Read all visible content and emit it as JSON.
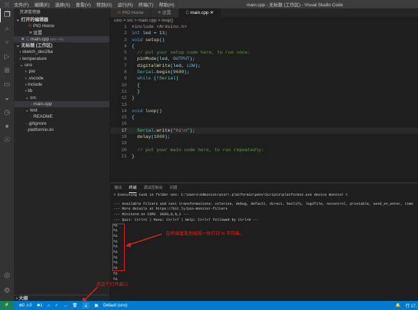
{
  "title": {
    "menus": [
      "文件(F)",
      "编辑(E)",
      "选择(S)",
      "查看(V)",
      "转到(G)",
      "运行(R)",
      "终端(T)",
      "帮助(H)"
    ],
    "window_title": "main.cpp - 无标题 (工作区) - Visual Studio Code"
  },
  "sidebar": {
    "header": "资源管理器",
    "open_editors": "打开的编辑器",
    "open": [
      {
        "label": "PIO Home"
      },
      {
        "label": "设置"
      },
      {
        "label": "main.cpp",
        "hint": "uno • src"
      }
    ],
    "workspace": "无标题 (工作区)",
    "tree": [
      {
        "label": "sketch_dec26a",
        "d": 1,
        "t": ">"
      },
      {
        "label": "temperature",
        "d": 1,
        "t": ">"
      },
      {
        "label": "uno",
        "d": 1,
        "t": "v"
      },
      {
        "label": ".pio",
        "d": 2,
        "t": ">"
      },
      {
        "label": ".vscode",
        "d": 2,
        "t": ">"
      },
      {
        "label": "include",
        "d": 2,
        "t": ">"
      },
      {
        "label": "lib",
        "d": 2,
        "t": ">"
      },
      {
        "label": "src",
        "d": 2,
        "t": "v"
      },
      {
        "label": "main.cpp",
        "d": 3,
        "t": ""
      },
      {
        "label": "test",
        "d": 2,
        "t": "v"
      },
      {
        "label": "README",
        "d": 3,
        "t": ""
      },
      {
        "label": ".gitignore",
        "d": 2,
        "t": ""
      },
      {
        "label": "platformio.ini",
        "d": 2,
        "t": ""
      }
    ],
    "outline": "大纲"
  },
  "tabs": [
    {
      "label": "PIO Home"
    },
    {
      "label": "设置"
    },
    {
      "label": "main.cpp"
    }
  ],
  "breadcrumb": "uno > src > main.cpp > loop()",
  "code": [
    "#include <Arduino.h>",
    "int led = 13;",
    "void setup()",
    "{",
    "  // put your setup code here, to run once:",
    "  pinMode(led, OUTPUT);",
    "  digitalWrite(led, LOW);",
    "  Serial.begin(9600);",
    "  while (!Serial)",
    "  {",
    "  }",
    "}",
    "",
    "void loop()",
    "{",
    "",
    "  Serial.write(\"hi\\n\");",
    "  delay(1000);",
    "",
    "  // put your main code here, to run repeatedly:",
    "}"
  ],
  "panel": {
    "tabs": [
      "输出",
      "终端",
      "调试控制台",
      "问题"
    ],
    "lines": [
      "> Executing task in folder uno: C:\\Users\\Administrator\\.platformio\\penv\\Scripts\\platformio.exe device monitor <",
      "",
      "--- Available filters and text transformations: colorize, debug, default, direct, hexlify, log2file, nocontrol, printable, send_on_enter, time",
      "--- More details at https://bit.ly/pio-monitor-filters",
      "--- Miniterm on COM3  9600,8,N,1 ---",
      "--- Quit: Ctrl+C | Menu: Ctrl+T | Help: Ctrl+T followed by Ctrl+H ---",
      "hi",
      "hi",
      "hi",
      "hi",
      "hi",
      "hi",
      "hi",
      "hi",
      "hi",
      "hi",
      "hi"
    ]
  },
  "annotations": {
    "terminal_note": "在终端里看到每隔一秒打印 hi 字符串。",
    "status_note": "点这个打开串口"
  },
  "status": {
    "errors": "⊗0 ⚠0",
    "branch": "✱1",
    "env": "Default (uno)",
    "position": "行 17,"
  }
}
